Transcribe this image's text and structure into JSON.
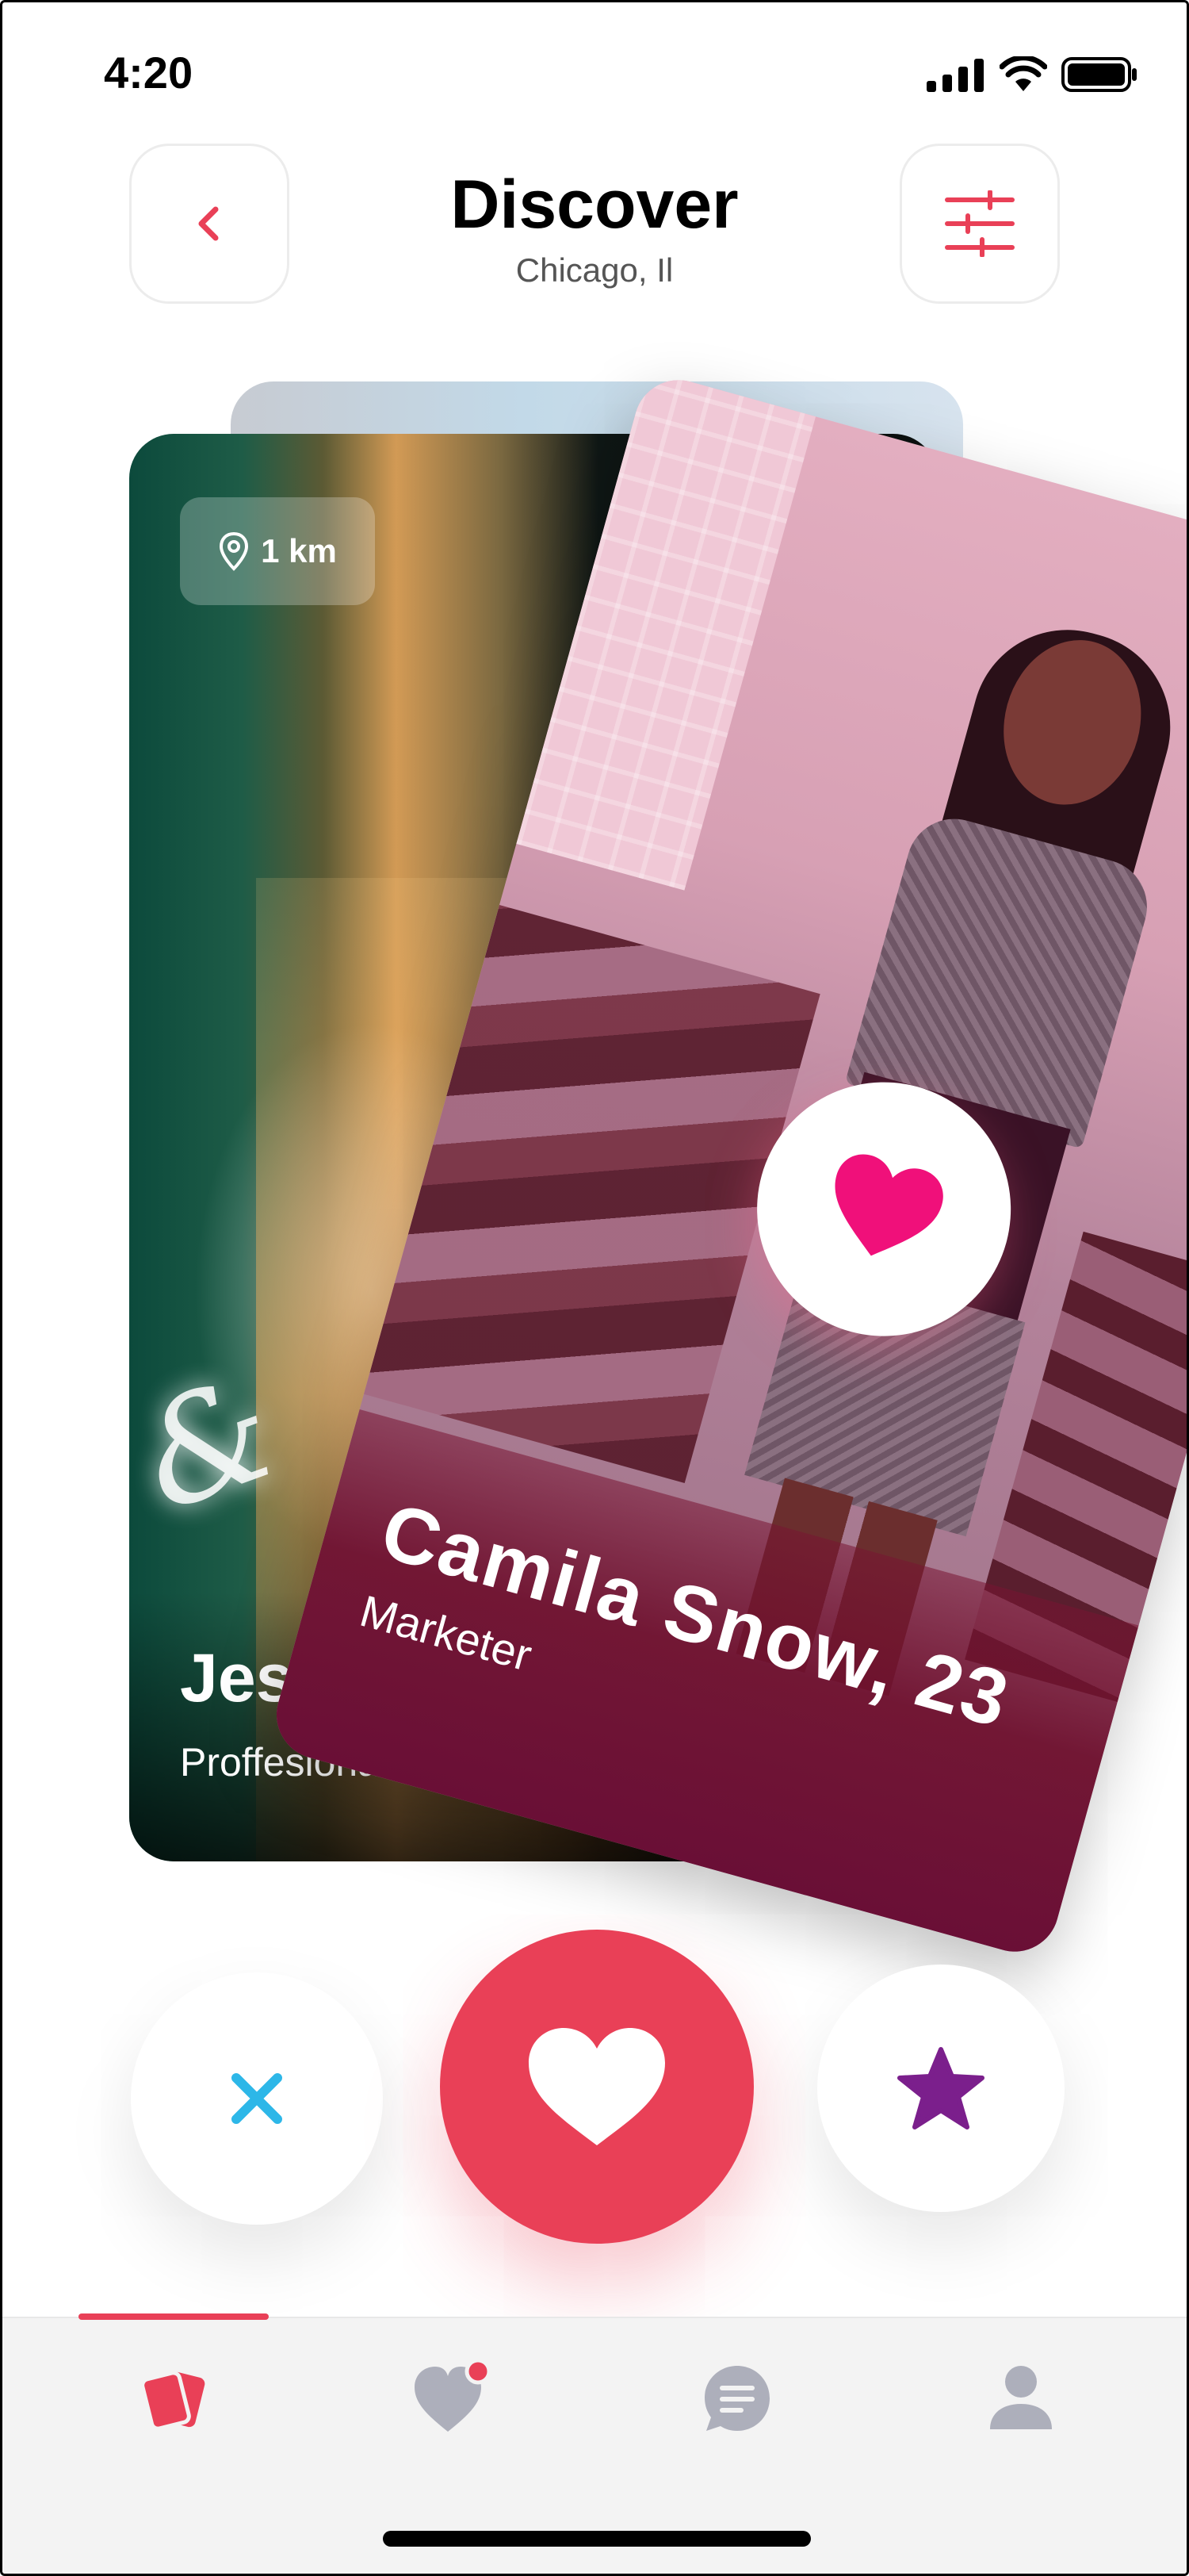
{
  "status_bar": {
    "time": "4:20"
  },
  "header": {
    "title": "Discover",
    "subtitle": "Chicago, Il",
    "back_icon": "chevron-left-icon",
    "filter_icon": "sliders-icon"
  },
  "cards": {
    "back": {
      "distance": "1 km",
      "name": "Jes",
      "occupation": "Proffesional moael"
    },
    "front": {
      "name": "Camila Snow, 23",
      "occupation": "Marketer",
      "badge_icon": "heart-icon"
    }
  },
  "actions": {
    "dislike_icon": "close-icon",
    "like_icon": "heart-icon",
    "superlike_icon": "star-icon"
  },
  "tabs": [
    {
      "icon": "cards-icon",
      "active": true
    },
    {
      "icon": "heart-notification-icon",
      "active": false
    },
    {
      "icon": "chat-icon",
      "active": false
    },
    {
      "icon": "profile-icon",
      "active": false
    }
  ],
  "colors": {
    "accent": "#E94057",
    "dislike": "#2DB7E8",
    "superlike": "#7B1F8C",
    "badge_heart": "#F0107A",
    "inactive_icon": "#ADAFBB"
  }
}
